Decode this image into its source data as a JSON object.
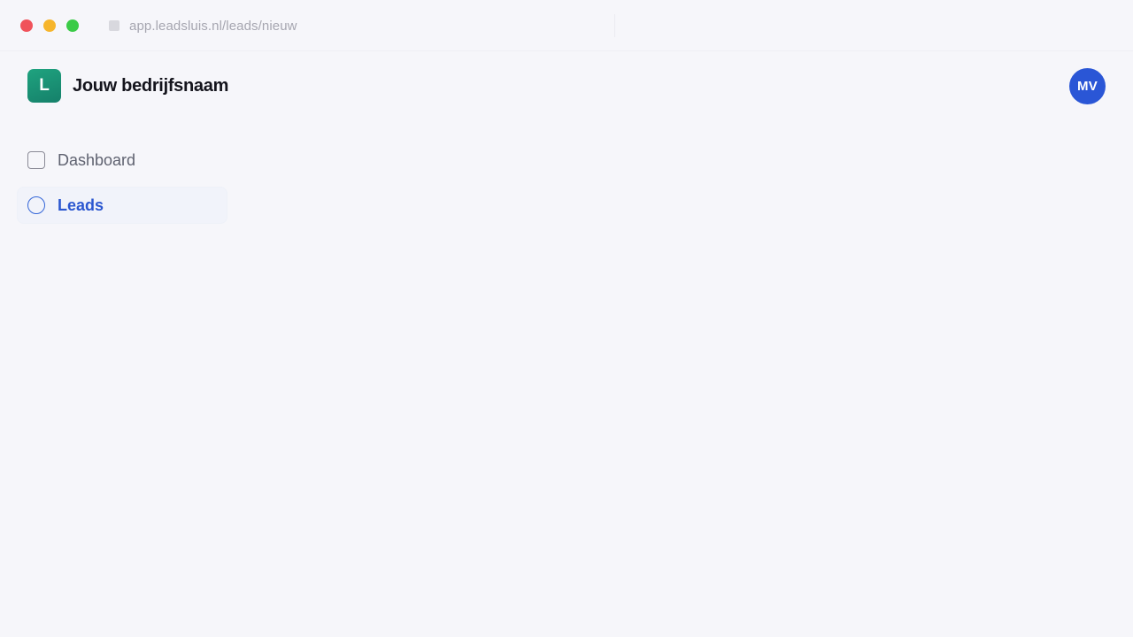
{
  "browser": {
    "url": "app.leadsluis.nl/leads/nieuw"
  },
  "header": {
    "logo_letter": "L",
    "company_name": "Jouw bedrijfsnaam",
    "avatar_initials": "MV"
  },
  "sidebar": {
    "items": [
      {
        "label": "Dashboard",
        "icon": "square-icon",
        "active": false
      },
      {
        "label": "Leads",
        "icon": "circle-icon",
        "active": true
      }
    ]
  },
  "colors": {
    "brand_green": "#1a9474",
    "accent_blue": "#2a56d6",
    "background": "#f6f6fa"
  }
}
